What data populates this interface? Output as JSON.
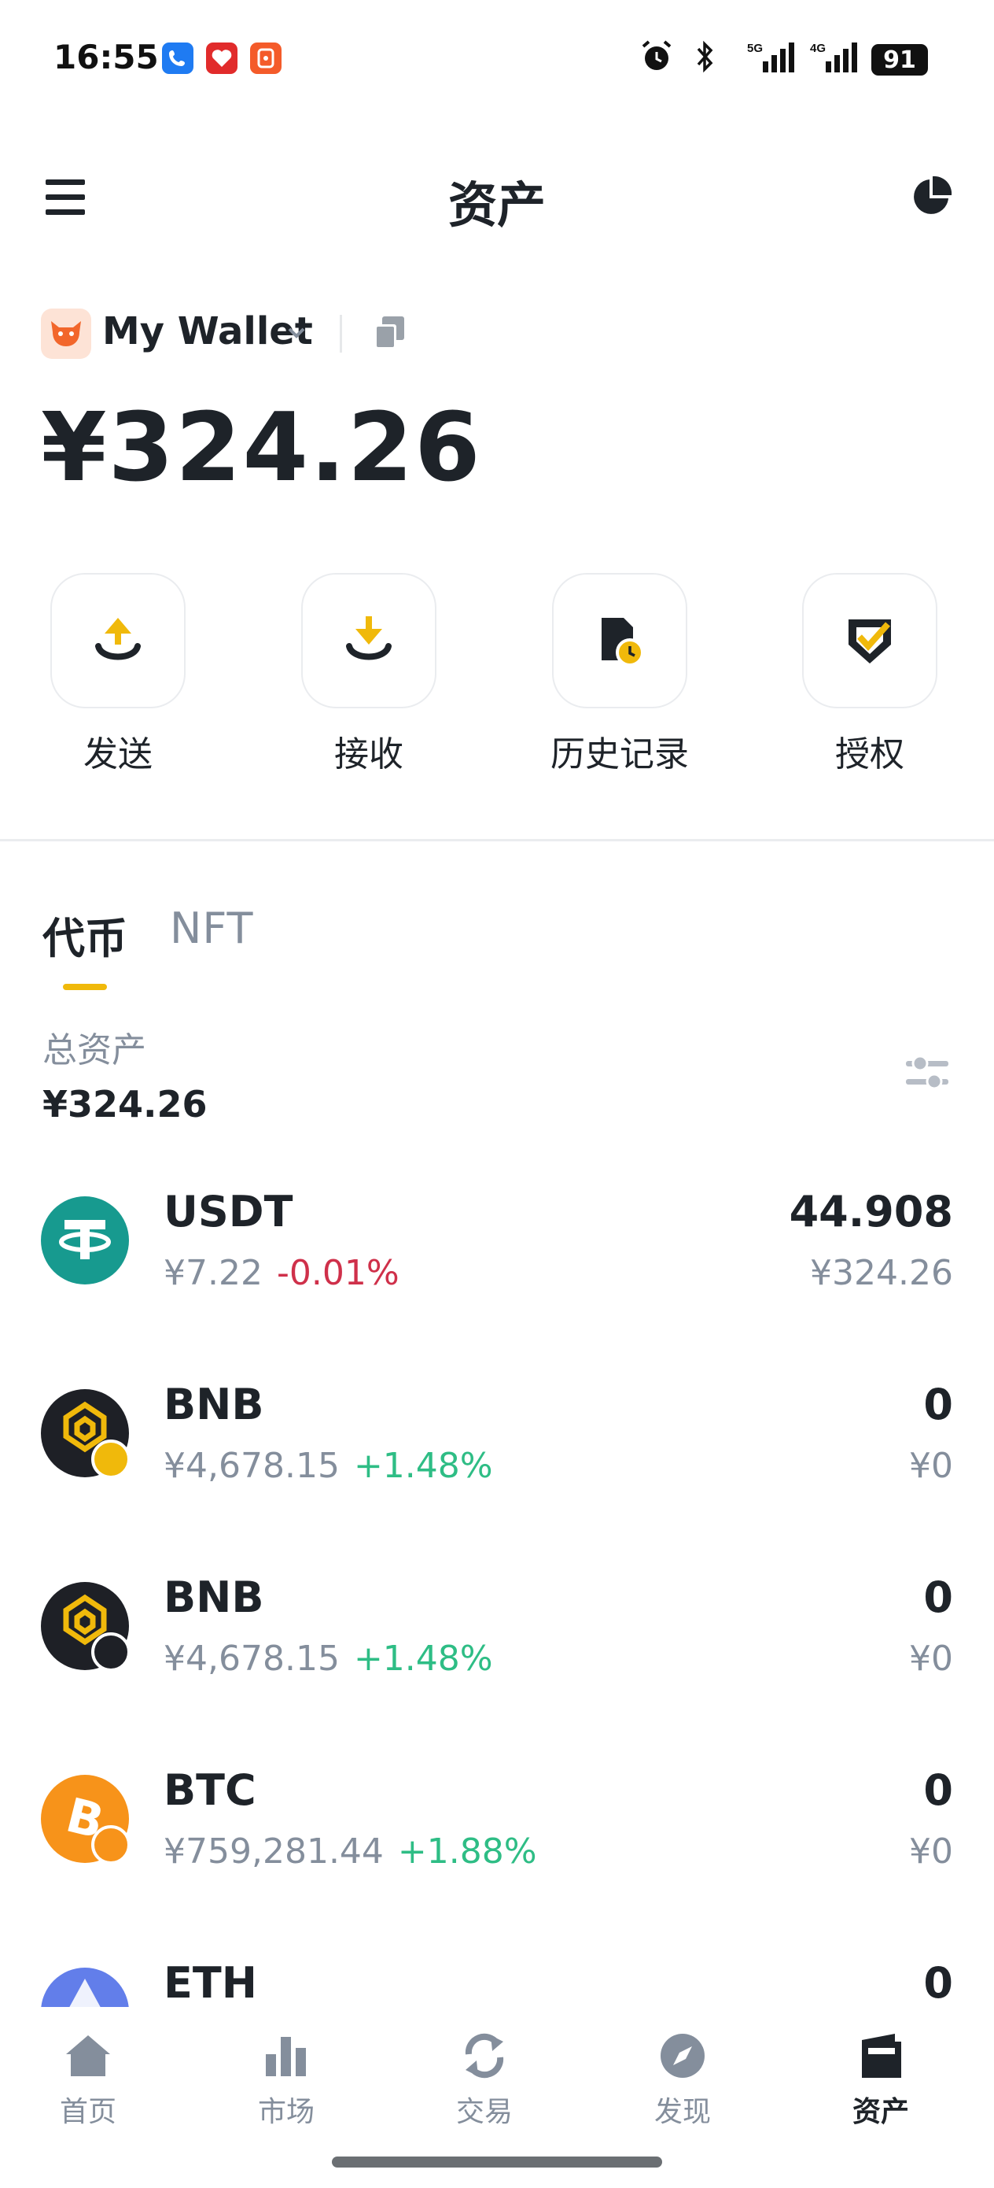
{
  "status_bar": {
    "time": "16:55",
    "battery": "91"
  },
  "header": {
    "title": "资产"
  },
  "wallet": {
    "name": "My Wallet",
    "balance": "¥324.26"
  },
  "actions": [
    {
      "label": "发送"
    },
    {
      "label": "接收"
    },
    {
      "label": "历史记录"
    },
    {
      "label": "授权"
    }
  ],
  "tabs": {
    "tokens": "代币",
    "nft": "NFT"
  },
  "total": {
    "label": "总资产",
    "value": "¥324.26"
  },
  "assets": [
    {
      "symbol": "USDT",
      "price": "¥7.22",
      "change": "-0.01%",
      "direction": "down",
      "amount": "44.908",
      "value": "¥324.26",
      "color": "#179a8f"
    },
    {
      "symbol": "BNB",
      "price": "¥4,678.15",
      "change": "+1.48%",
      "direction": "up",
      "amount": "0",
      "value": "¥0",
      "color": "#1e2026"
    },
    {
      "symbol": "BNB",
      "price": "¥4,678.15",
      "change": "+1.48%",
      "direction": "up",
      "amount": "0",
      "value": "¥0",
      "color": "#1e2026"
    },
    {
      "symbol": "BTC",
      "price": "¥759,281.44",
      "change": "+1.88%",
      "direction": "up",
      "amount": "0",
      "value": "¥0",
      "color": "#f7931a"
    },
    {
      "symbol": "ETH",
      "price": "",
      "change": "",
      "direction": "up",
      "amount": "0",
      "value": "",
      "color": "#627eea"
    }
  ],
  "bottom_nav": [
    {
      "label": "首页",
      "icon": "home-icon"
    },
    {
      "label": "市场",
      "icon": "market-icon"
    },
    {
      "label": "交易",
      "icon": "swap-icon"
    },
    {
      "label": "发现",
      "icon": "compass-icon"
    },
    {
      "label": "资产",
      "icon": "wallet-icon",
      "active": true
    }
  ],
  "colors": {
    "accent": "#f0b90b",
    "up": "#2ebd85",
    "down": "#cf304a",
    "muted": "#848e9c"
  }
}
